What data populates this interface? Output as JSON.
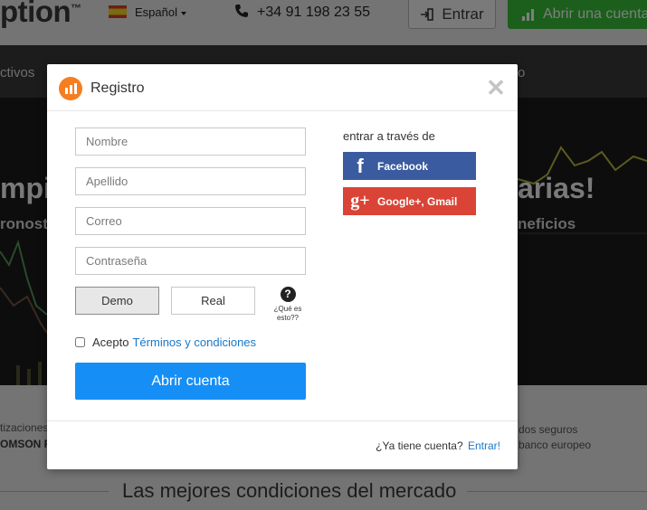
{
  "background": {
    "logo": "ption",
    "logo_tm": "™",
    "language": "Español",
    "phone": "+34 91 198 23 55",
    "login_label": "Entrar",
    "open_account_label": "Abrir una cuenta",
    "nav_left": "ctivos",
    "nav_right": "o",
    "hero_title_left": "mpio",
    "hero_title_right": "arias!",
    "hero_sub_left": "ronosti",
    "hero_sub_right": "neficios",
    "lower_left_1": "tizaciones",
    "lower_left_2": "OMSON R",
    "lower_right_1": "dos seguros",
    "lower_right_2": "banco europeo",
    "conditions_heading": "Las mejores condiciones del mercado"
  },
  "modal": {
    "title": "Registro",
    "close_symbol": "✕",
    "fields": {
      "first_name_placeholder": "Nombre",
      "last_name_placeholder": "Apellido",
      "email_placeholder": "Correo",
      "password_placeholder": "Contraseña"
    },
    "account_types": {
      "demo": "Demo",
      "real": "Real",
      "selected": "Demo"
    },
    "help": {
      "symbol": "?",
      "text": "¿Qué es esto??"
    },
    "terms": {
      "prefix": "Acepto",
      "link": "Términos y condiciones",
      "checked": false
    },
    "submit_label": "Abrir cuenta",
    "social": {
      "label": "entrar a través de",
      "facebook": "Facebook",
      "facebook_icon": "f",
      "google": "Google+, Gmail",
      "google_icon": "g+",
      "facebook_color": "#3a5b9f",
      "google_color": "#d94436"
    },
    "footer": {
      "question": "¿Ya tiene cuenta?",
      "link": "Entrar!"
    },
    "accent_color": "#158ff6",
    "brand_color": "#f57f20"
  }
}
